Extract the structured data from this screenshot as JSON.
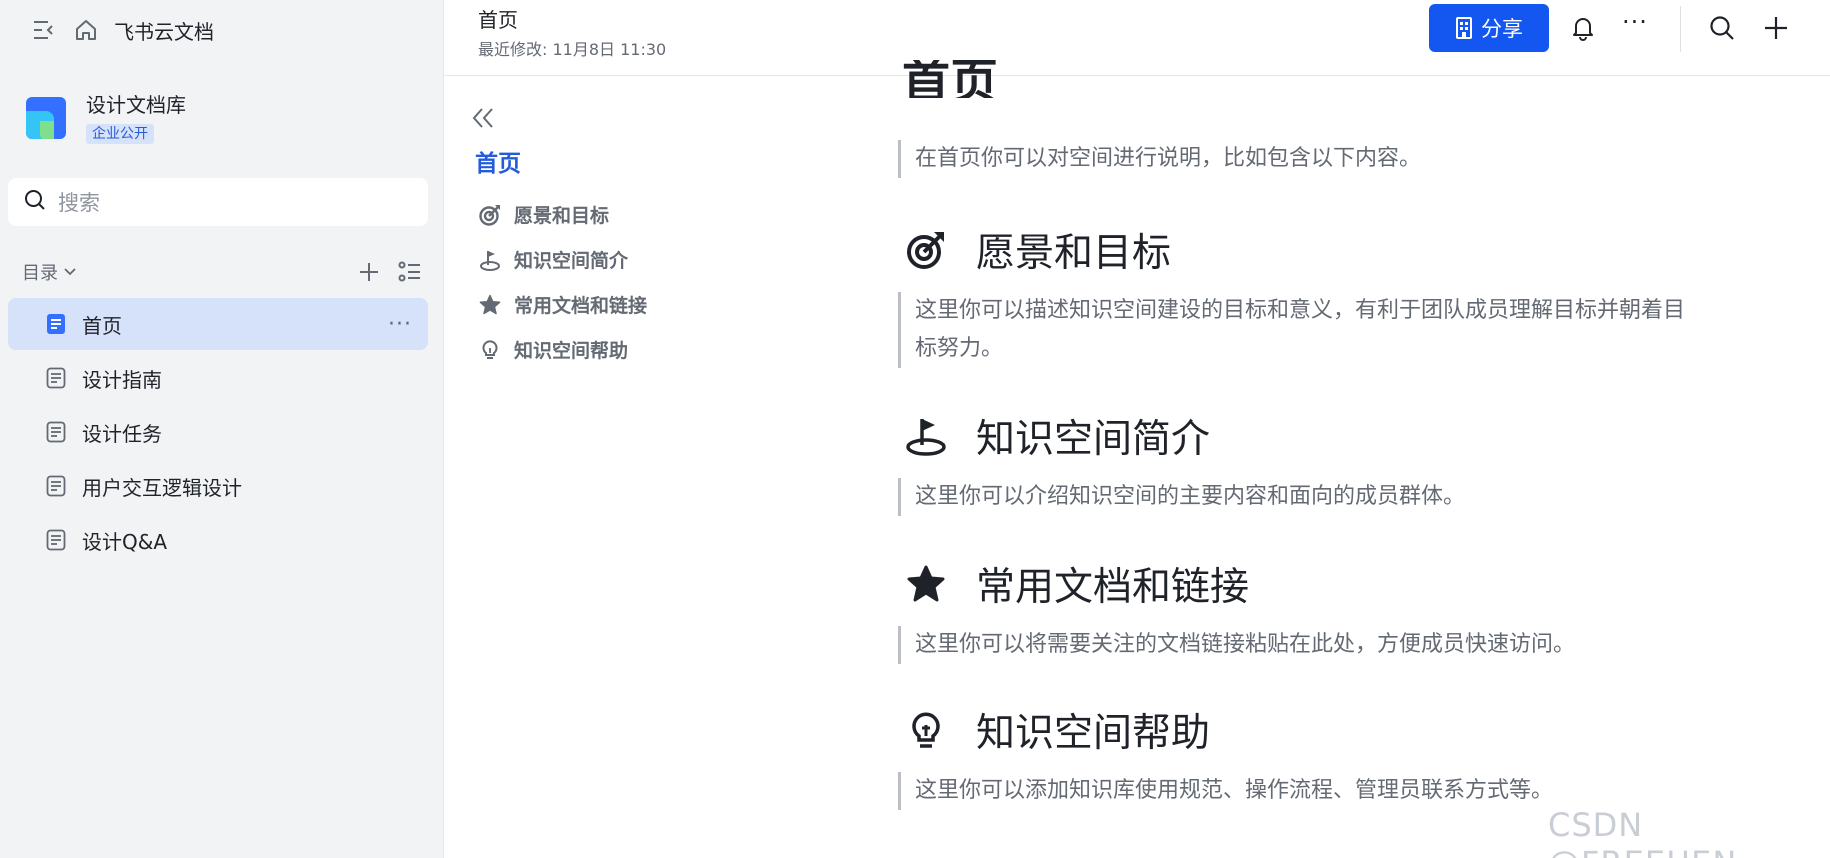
{
  "sidebar": {
    "brand": "飞书云文档",
    "space": {
      "name": "设计文档库",
      "badge": "企业公开"
    },
    "search": {
      "placeholder": "搜索"
    },
    "toc_label": "目录",
    "items": [
      {
        "label": "首页",
        "active": true
      },
      {
        "label": "设计指南"
      },
      {
        "label": "设计任务"
      },
      {
        "label": "用户交互逻辑设计"
      },
      {
        "label": "设计Q&A"
      }
    ],
    "more": "···"
  },
  "header": {
    "title": "首页",
    "subtitle": "最近修改: 11月8日 11:30",
    "share_label": "分享",
    "more": "···"
  },
  "outline": {
    "current": "首页",
    "items": [
      {
        "label": "愿景和目标",
        "icon": "target-icon"
      },
      {
        "label": "知识空间简介",
        "icon": "golf-icon"
      },
      {
        "label": "常用文档和链接",
        "icon": "star-icon"
      },
      {
        "label": "知识空间帮助",
        "icon": "bulb-icon"
      }
    ]
  },
  "content": {
    "page_title": "首页",
    "intro": "在首页你可以对空间进行说明，比如包含以下内容。",
    "sections": [
      {
        "heading": "愿景和目标",
        "icon": "target-icon",
        "body": [
          "这里你可以描述知识空间建设的目标和意义，有利于团队成员理解目标并朝着目",
          "标努力。"
        ]
      },
      {
        "heading": "知识空间简介",
        "icon": "golf-icon",
        "body": [
          "这里你可以介绍知识空间的主要内容和面向的成员群体。"
        ]
      },
      {
        "heading": "常用文档和链接",
        "icon": "star-icon",
        "body": [
          "这里你可以将需要关注的文档链接粘贴在此处，方便成员快速访问。"
        ]
      },
      {
        "heading": "知识空间帮助",
        "icon": "bulb-icon",
        "body": [
          "这里你可以添加知识库使用规范、操作流程、管理员联系方式等。"
        ]
      }
    ]
  },
  "watermark": "CSDN @FREEHEN",
  "colors": {
    "accent": "#1456f0",
    "active_bg": "#d6e1fa",
    "sidebar_bg": "#f2f3f5"
  }
}
